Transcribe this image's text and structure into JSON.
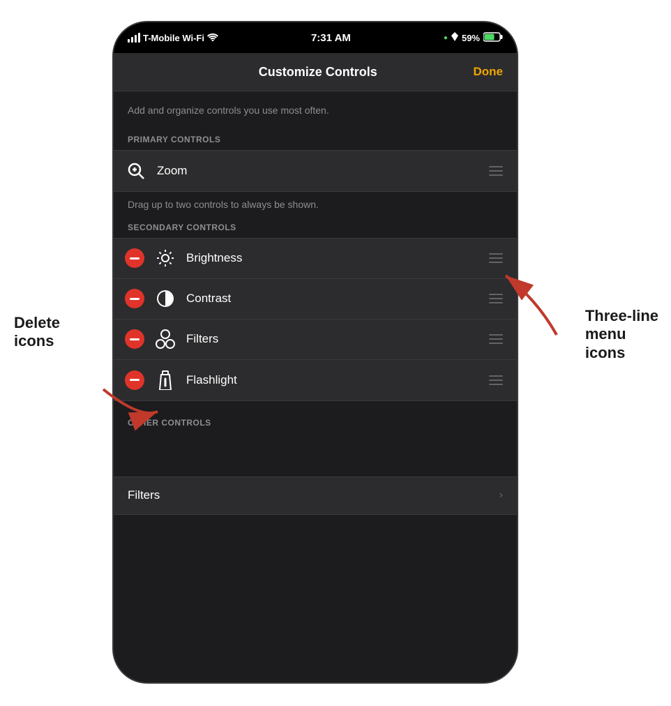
{
  "statusBar": {
    "carrier": "T-Mobile Wi-Fi",
    "time": "7:31 AM",
    "battery": "59%",
    "location_dot": "●"
  },
  "navBar": {
    "title": "Customize Controls",
    "done_label": "Done"
  },
  "sections": {
    "desc": "Add and organize controls you use most often.",
    "primary_header": "PRIMARY CONTROLS",
    "primary_items": [
      {
        "label": "Zoom"
      }
    ],
    "drag_hint": "Drag up to two controls to always be shown.",
    "secondary_header": "SECONDARY CONTROLS",
    "secondary_items": [
      {
        "label": "Brightness",
        "icon": "brightness"
      },
      {
        "label": "Contrast",
        "icon": "contrast"
      },
      {
        "label": "Filters",
        "icon": "filters"
      },
      {
        "label": "Flashlight",
        "icon": "flashlight"
      }
    ],
    "other_header": "OTHER CONTROLS"
  },
  "bottomRow": {
    "label": "Filters",
    "chevron": "›"
  },
  "annotations": {
    "delete_label": "Delete\nicons",
    "menu_label": "Three-line\nmenu\nicons"
  }
}
